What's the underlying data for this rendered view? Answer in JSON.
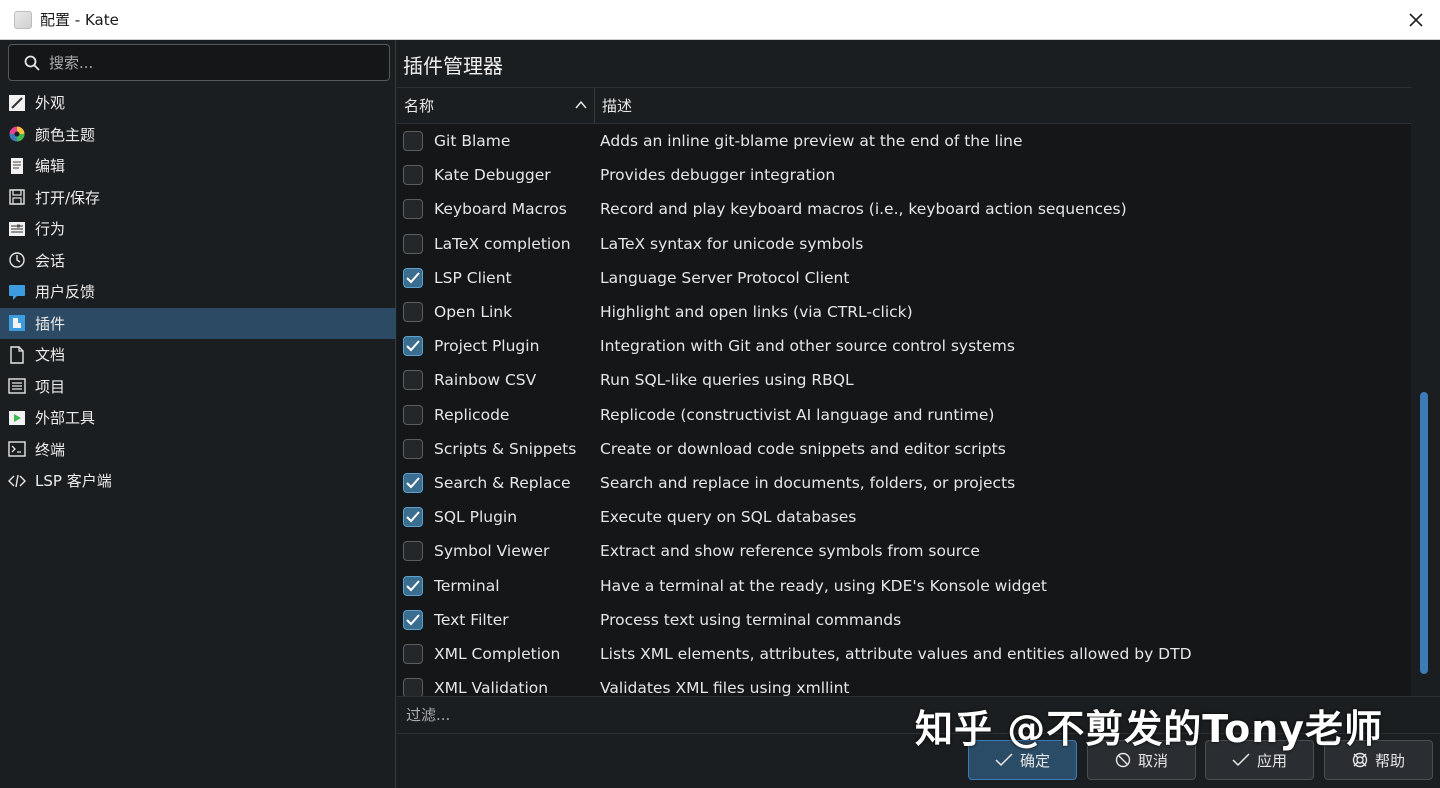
{
  "window": {
    "title": "配置 - Kate"
  },
  "sidebar": {
    "search_placeholder": "搜索...",
    "items": [
      {
        "label": "外观",
        "icon": "appearance-icon"
      },
      {
        "label": "颜色主题",
        "icon": "color-theme-icon"
      },
      {
        "label": "编辑",
        "icon": "edit-icon"
      },
      {
        "label": "打开/保存",
        "icon": "save-icon"
      },
      {
        "label": "行为",
        "icon": "behavior-icon"
      },
      {
        "label": "会话",
        "icon": "session-clock-icon"
      },
      {
        "label": "用户反馈",
        "icon": "feedback-icon"
      },
      {
        "label": "插件",
        "icon": "plugins-icon",
        "active": true
      },
      {
        "label": "文档",
        "icon": "document-icon"
      },
      {
        "label": "项目",
        "icon": "project-icon"
      },
      {
        "label": "外部工具",
        "icon": "external-tools-icon"
      },
      {
        "label": "终端",
        "icon": "terminal-icon"
      },
      {
        "label": "LSP 客户端",
        "icon": "code-icon"
      }
    ]
  },
  "main": {
    "title": "插件管理器",
    "columns": {
      "name": "名称",
      "description": "描述"
    },
    "plugins": [
      {
        "name": "Git Blame",
        "description": "Adds an inline git-blame preview at the end of the line",
        "enabled": false
      },
      {
        "name": "Kate Debugger",
        "description": "Provides debugger integration",
        "enabled": false
      },
      {
        "name": "Keyboard Macros",
        "description": "Record and play keyboard macros (i.e., keyboard action sequences)",
        "enabled": false
      },
      {
        "name": "LaTeX completion",
        "description": "LaTeX syntax for unicode symbols",
        "enabled": false
      },
      {
        "name": "LSP Client",
        "description": "Language Server Protocol Client",
        "enabled": true
      },
      {
        "name": "Open Link",
        "description": "Highlight and open links (via CTRL-click)",
        "enabled": false
      },
      {
        "name": "Project Plugin",
        "description": "Integration with Git and other source control systems",
        "enabled": true
      },
      {
        "name": "Rainbow CSV",
        "description": "Run SQL-like queries using RBQL",
        "enabled": false
      },
      {
        "name": "Replicode",
        "description": "Replicode (constructivist AI language and runtime)",
        "enabled": false
      },
      {
        "name": "Scripts & Snippets",
        "description": "Create or download code snippets and editor scripts",
        "enabled": false
      },
      {
        "name": "Search & Replace",
        "description": "Search and replace in documents, folders, or projects",
        "enabled": true
      },
      {
        "name": "SQL Plugin",
        "description": "Execute query on SQL databases",
        "enabled": true
      },
      {
        "name": "Symbol Viewer",
        "description": "Extract and show reference symbols from source",
        "enabled": false
      },
      {
        "name": "Terminal",
        "description": "Have a terminal at the ready, using KDE's Konsole widget",
        "enabled": true
      },
      {
        "name": "Text Filter",
        "description": "Process text using terminal commands",
        "enabled": true
      },
      {
        "name": "XML Completion",
        "description": "Lists XML elements, attributes, attribute values and entities allowed by DTD",
        "enabled": false
      },
      {
        "name": "XML Validation",
        "description": "Validates XML files using xmllint",
        "enabled": false
      }
    ],
    "filter_placeholder": "过滤..."
  },
  "buttons": {
    "ok": "确定",
    "cancel": "取消",
    "apply": "应用",
    "help": "帮助"
  },
  "watermark": "知乎 @不剪发的Tony老师",
  "colors": {
    "accent": "#3d7ab8",
    "selected": "#2c4a63",
    "checkbox_checked": "#3a6d8e"
  }
}
